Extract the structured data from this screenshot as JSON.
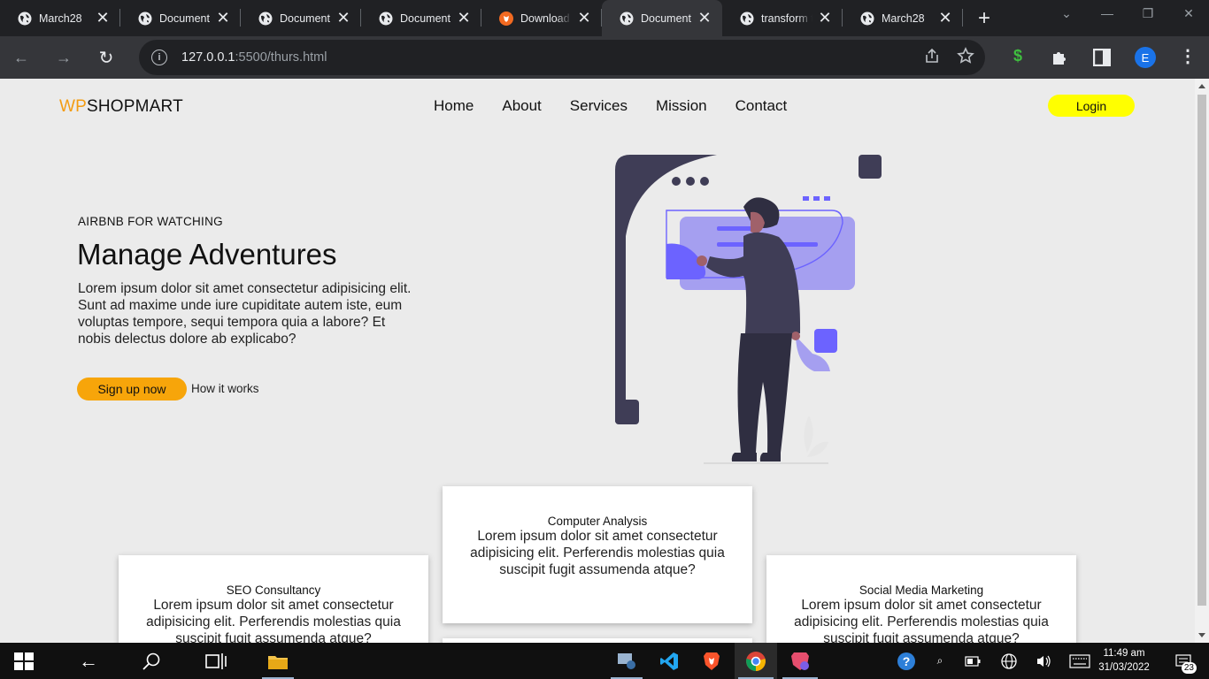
{
  "browser": {
    "tabs": [
      {
        "title": "March28",
        "active": false,
        "icon": "globe-icon"
      },
      {
        "title": "Document",
        "active": false,
        "icon": "globe-icon"
      },
      {
        "title": "Document",
        "active": false,
        "icon": "globe-icon"
      },
      {
        "title": "Document",
        "active": false,
        "icon": "globe-icon"
      },
      {
        "title": "Download I",
        "active": false,
        "icon": "brave-icon"
      },
      {
        "title": "Document",
        "active": true,
        "icon": "globe-icon"
      },
      {
        "title": "transform t",
        "active": false,
        "icon": "globe-icon"
      },
      {
        "title": "March28",
        "active": false,
        "icon": "globe-icon"
      }
    ],
    "url_host": "127.0.0.1",
    "url_rest": ":5500/thurs.html",
    "profile_initial": "E"
  },
  "page": {
    "logo_accent": "WP",
    "logo_rest": "SHOPMART",
    "nav": [
      "Home",
      "About",
      "Services",
      "Mission",
      "Contact"
    ],
    "login": "Login",
    "hero": {
      "eyebrow": "AIRBNB FOR WATCHING",
      "title": "Manage Adventures",
      "body": "Lorem ipsum dolor sit amet consectetur adipisicing elit. Sunt ad maxime unde iure cupiditate autem iste, eum voluptas tempore, sequi tempora quia a labore? Et nobis delectus dolore ab explicabo?",
      "signup": "Sign up now",
      "how": "How it works"
    },
    "cards": [
      {
        "title": "SEO Consultancy",
        "text": "Lorem ipsum dolor sit amet consectetur adipisicing elit. Perferendis molestias quia suscipit fugit assumenda atque?"
      },
      {
        "title": "Computer Analysis",
        "text": "Lorem ipsum dolor sit amet consectetur adipisicing elit. Perferendis molestias quia suscipit fugit assumenda atque?"
      },
      {
        "title": "Social Media Marketing",
        "text": "Lorem ipsum dolor sit amet consectetur adipisicing elit. Perferendis molestias quia suscipit fugit assumenda atque?"
      }
    ]
  },
  "taskbar": {
    "time": "11:49 am",
    "date": "31/03/2022",
    "notifications": "23"
  },
  "colors": {
    "accent_orange": "#f7a50a",
    "login_yellow": "#ffff00",
    "illustration_purple": "#6c63ff",
    "page_bg": "#ebebeb"
  }
}
